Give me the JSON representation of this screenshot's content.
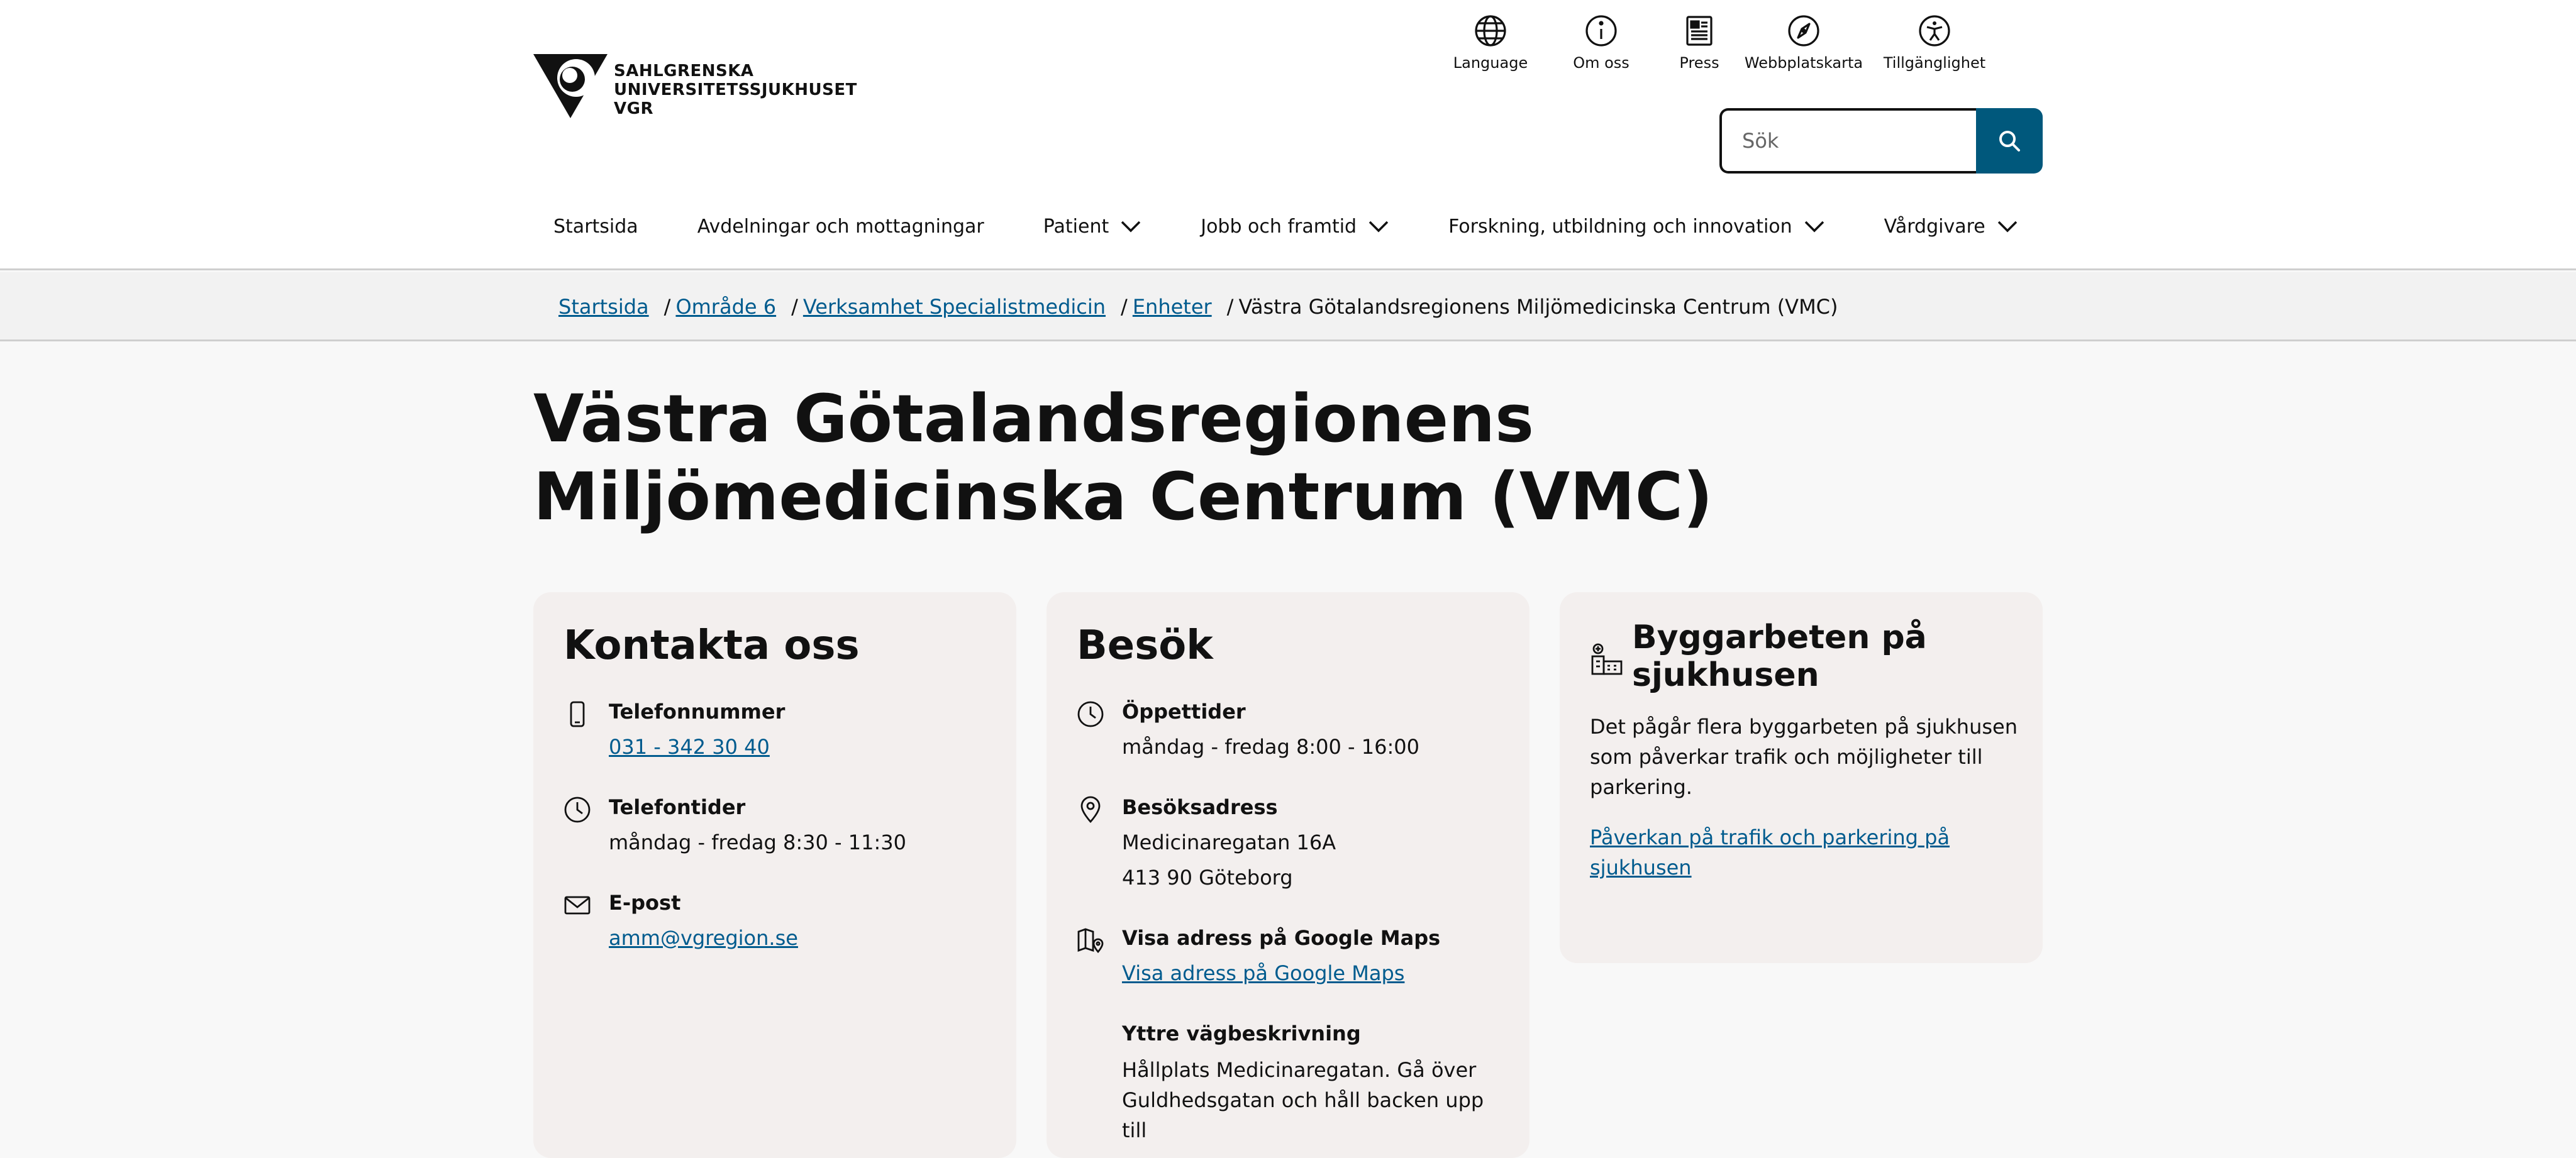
{
  "logo": {
    "lines": [
      "SAHLGRENSKA",
      "UNIVERSITETSSJUKHUSET",
      "VGR"
    ]
  },
  "utility_nav": [
    {
      "label": "Language",
      "icon": "globe-icon"
    },
    {
      "label": "Om oss",
      "icon": "info-icon"
    },
    {
      "label": "Press",
      "icon": "newspaper-icon"
    },
    {
      "label": "Webbplatskarta",
      "icon": "compass-icon"
    },
    {
      "label": "Tillgänglighet",
      "icon": "accessibility-icon"
    }
  ],
  "search": {
    "placeholder": "Sök",
    "button_icon": "search-icon"
  },
  "main_nav": [
    {
      "label": "Startsida",
      "dropdown": false
    },
    {
      "label": "Avdelningar och mottagningar",
      "dropdown": false
    },
    {
      "label": "Patient",
      "dropdown": true
    },
    {
      "label": "Jobb och framtid",
      "dropdown": true
    },
    {
      "label": "Forskning, utbildning och innovation",
      "dropdown": true
    },
    {
      "label": "Vårdgivare",
      "dropdown": true
    }
  ],
  "breadcrumb": {
    "items": [
      "Startsida",
      "Område 6",
      "Verksamhet Specialistmedicin",
      "Enheter"
    ],
    "separator": "/",
    "current": "Västra Götalandsregionens Miljömedicinska Centrum (VMC)"
  },
  "page": {
    "title": "Västra Götalandsregionens Miljömedicinska Centrum (VMC)"
  },
  "contact": {
    "heading": "Kontakta oss",
    "phone_label": "Telefonnummer",
    "phone_value": "031 - 342 30 40",
    "hours_label": "Telefontider",
    "hours_value": "måndag - fredag 8:30 - 11:30",
    "email_label": "E-post",
    "email_value": "amm@vgregion.se"
  },
  "visit": {
    "heading": "Besök",
    "open_label": "Öppettider",
    "open_value": "måndag - fredag 8:00 - 16:00",
    "address_label": "Besöksadress",
    "address_line1": "Medicinaregatan 16A",
    "address_line2": "413 90 Göteborg",
    "maps_label": "Visa adress på Google Maps",
    "maps_link": "Visa adress på Google Maps",
    "directions_label": "Yttre vägbeskrivning",
    "directions_text": "Hållplats Medicinaregatan. Gå över Guldhedsgatan och håll backen upp till"
  },
  "construction": {
    "heading": "Byggarbeten på sjukhusen",
    "text": "Det pågår flera byggarbeten på sjukhusen som påverkar trafik och möjligheter till parkering.",
    "link": "Påverkan på trafik och parkering på sjukhusen"
  },
  "colors": {
    "accent": "#00587c",
    "link": "#005b8e",
    "card_bg": "#f3efee",
    "page_bg": "#f8f8f8"
  }
}
